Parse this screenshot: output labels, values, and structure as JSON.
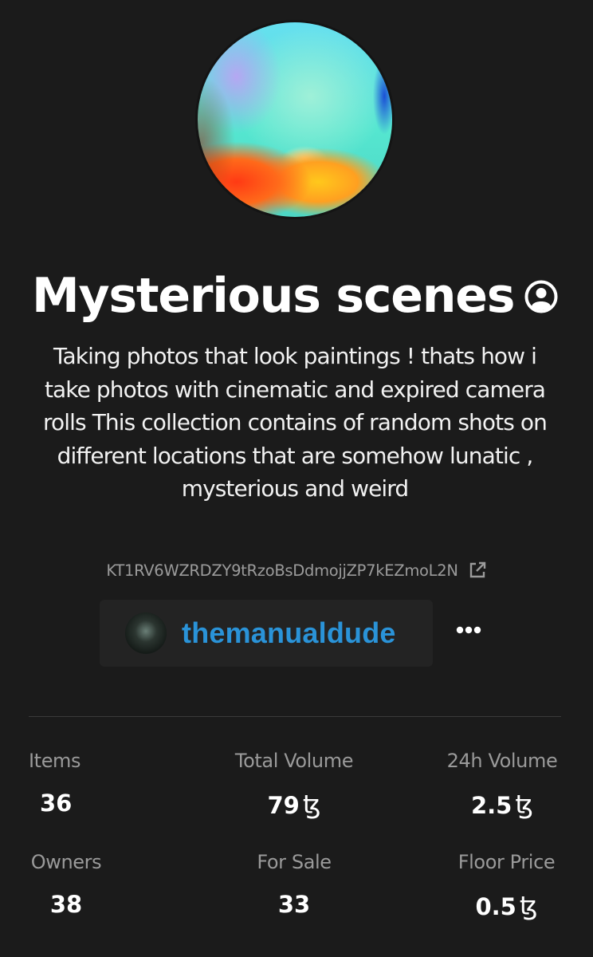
{
  "collection": {
    "title": "Mysterious scenes",
    "description": "Taking photos that look paintings ! thats how i take photos with cinematic and expired camera rolls This collection contains of random shots on different locations that are somehow lunatic , mysterious and weird",
    "contract_address": "KT1RV6WZRDZY9tRzoBsDdmojjZP7kEZmoL2N",
    "icons": {
      "profile": "user-circle-icon",
      "external_link": "external-link-icon",
      "more": "more-horizontal-icon"
    }
  },
  "creator": {
    "name": "themanualdude",
    "name_color": "#2a93d8"
  },
  "more_label": "•••",
  "currency_symbol": "ꜩ",
  "stats": {
    "items": {
      "label": "Items",
      "value": "36"
    },
    "total_volume": {
      "label": "Total Volume",
      "value": "79"
    },
    "volume_24h": {
      "label": "24h Volume",
      "value": "2.5"
    },
    "owners": {
      "label": "Owners",
      "value": "38"
    },
    "for_sale": {
      "label": "For Sale",
      "value": "33"
    },
    "floor_price": {
      "label": "Floor Price",
      "value": "0.5"
    }
  }
}
